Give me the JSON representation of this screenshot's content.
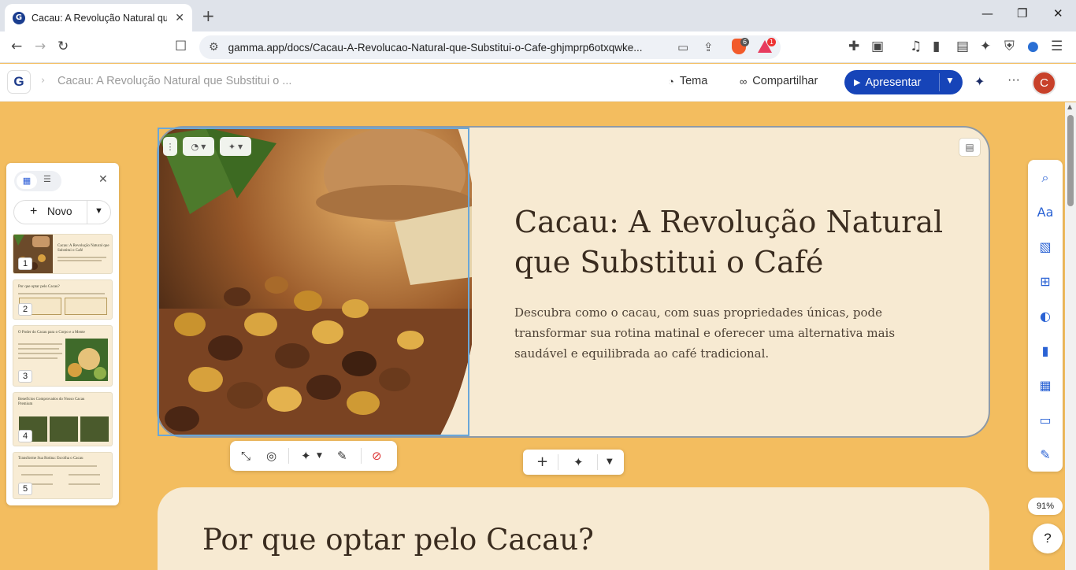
{
  "browser": {
    "tab_title": "Cacau: A Revolução Natural que Substitui o Café",
    "url": "gamma.app/docs/Cacau-A-Revolucao-Natural-que-Substitui-o-Cafe-ghjmprp6otxqwke...",
    "brave_badge": "6",
    "alert_badge": "1"
  },
  "app": {
    "logo": "G",
    "breadcrumb": "Cacau: A Revolução Natural que Substitui o ...",
    "theme_label": "Tema",
    "share_label": "Compartilhar",
    "present_label": "Apresentar",
    "avatar_initial": "C"
  },
  "panel": {
    "new_label": "Novo",
    "thumbnails": [
      {
        "number": "1",
        "title": "Cacau: A Revolução Natural que Substitui o Café"
      },
      {
        "number": "2",
        "title": "Por que optar pelo Cacau?"
      },
      {
        "number": "3",
        "title": "O Poder do Cacau para o Corpo e a Mente"
      },
      {
        "number": "4",
        "title": "Benefícios Comprovados do Nosso Cacau Premium"
      },
      {
        "number": "5",
        "title": "Transforme Sua Rotina: Escolha o Cacau"
      }
    ]
  },
  "slide1": {
    "title": "Cacau: A Revolução Natural que Substitui o Café",
    "lead": "Descubra como o cacau, com suas propriedades únicas, pode transformar sua rotina matinal e oferecer uma alternativa mais saudável e equilibrada ao café tradicional."
  },
  "slide2": {
    "title": "Por que optar pelo Cacau?"
  },
  "zoom": "91%",
  "help": "?",
  "colors": {
    "page_bg": "#f3bd5f",
    "card_bg": "#f7ead2",
    "accent": "#1644b8",
    "heading": "#3a2c1f"
  }
}
